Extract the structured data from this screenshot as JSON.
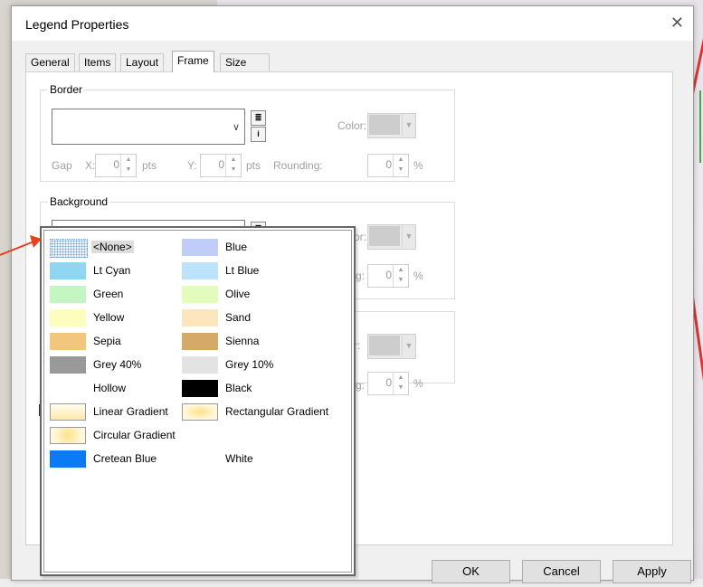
{
  "window": {
    "title": "Legend Properties"
  },
  "tabs": [
    "General",
    "Items",
    "Layout",
    "Frame",
    "Size and Position"
  ],
  "active_tab": "Frame",
  "border": {
    "label": "Border",
    "color_label": "Color:",
    "gap_label": "Gap",
    "x_label": "X:",
    "x_value": "0",
    "y_label": "Y:",
    "y_value": "0",
    "unit": "pts",
    "rounding_label": "Rounding:",
    "rounding_value": "0",
    "pct": "%"
  },
  "background": {
    "label": "Background",
    "color_label": "Color:",
    "rounding_value": "0",
    "rounding_partial": "g:",
    "pct": "%"
  },
  "shadow": {
    "color_partial": "r:",
    "rounding_partial": "g:",
    "rounding_value": "0",
    "pct": "%"
  },
  "dropdown_items": [
    {
      "label": "<None>",
      "swatch": "dots",
      "selected": true
    },
    {
      "label": "Blue",
      "swatch": "#c0cdf9"
    },
    {
      "label": "Lt Cyan",
      "swatch": "#8fd6f0"
    },
    {
      "label": "Lt Blue",
      "swatch": "#bde3fb"
    },
    {
      "label": "Green",
      "swatch": "#c4f6c4"
    },
    {
      "label": "Olive",
      "swatch": "#e3fbbd"
    },
    {
      "label": "Yellow",
      "swatch": "#fdfdbd"
    },
    {
      "label": "Sand",
      "swatch": "#fde5bd"
    },
    {
      "label": "Sepia",
      "swatch": "#f3c67d"
    },
    {
      "label": "Sienna",
      "swatch": "#d5aa68"
    },
    {
      "label": "Grey 40%",
      "swatch": "#999999"
    },
    {
      "label": "Grey 10%",
      "swatch": "#e3e3e3"
    },
    {
      "label": "Hollow",
      "swatch": "none"
    },
    {
      "label": "Black",
      "swatch": "#000000"
    },
    {
      "label": "Linear Gradient",
      "swatch": "linear"
    },
    {
      "label": "Rectangular Gradient",
      "swatch": "rect"
    },
    {
      "label": "Circular Gradient",
      "swatch": "radial"
    },
    {
      "label": "Cretean Blue",
      "swatch": "#0a7af5"
    },
    {
      "label": "White",
      "swatch": "#ffffff"
    }
  ],
  "buttons": {
    "ok": "OK",
    "cancel": "Cancel",
    "apply": "Apply"
  },
  "icons": [
    "close-icon",
    "chevron-down-icon",
    "list-icon",
    "info-icon",
    "spin-up-down-icon",
    "red-pointer-arrow"
  ],
  "colors": {
    "arrow": "#e8401c",
    "selected_bg": "#dcdcdc"
  }
}
